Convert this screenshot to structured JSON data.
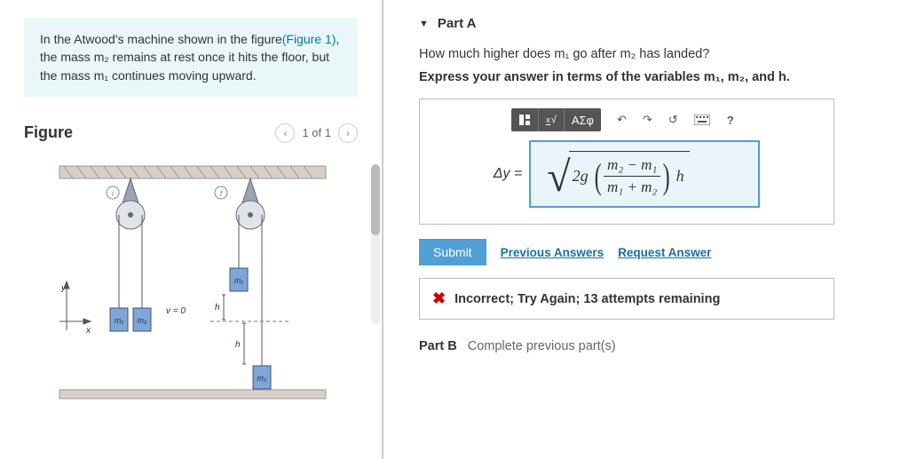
{
  "intro": {
    "prefix": "In the Atwood's machine shown in the figure",
    "link_text": "(Figure 1)",
    "rest": ", the mass m₂ remains at rest once it hits the floor, but the mass m₁ continues moving upward."
  },
  "figure": {
    "title": "Figure",
    "page": "1 of 1"
  },
  "partA": {
    "label": "Part A",
    "question": "How much higher does m₁ go after m₂ has landed?",
    "instruction": "Express your answer in terms of the variables m₁, m₂, and h.",
    "toolbar": {
      "template": "template",
      "frac_sqrt": "x√",
      "greek": "ΑΣφ",
      "undo": "↶",
      "redo": "↷",
      "reset": "↺",
      "keyboard": "⌨",
      "help": "?"
    },
    "answer": {
      "lhs": "Δy =",
      "expr": {
        "coef": "2g",
        "num": "m₂ − m₁",
        "den": "m₁ + m₂",
        "tail": "h"
      }
    },
    "submit": "Submit",
    "prev_answers": "Previous Answers",
    "request_answer": "Request Answer",
    "feedback": "Incorrect; Try Again; 13 attempts remaining"
  },
  "partB": {
    "label": "Part B",
    "status": "Complete previous part(s)"
  }
}
